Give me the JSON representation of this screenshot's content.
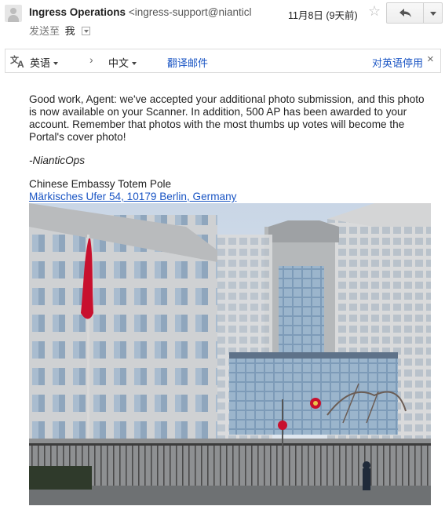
{
  "header": {
    "sender_name": "Ingress Operations",
    "sender_email": "<ingress-support@nianticl",
    "date": "11月8日 (9天前)",
    "to_label": "发送至",
    "to_value": "我"
  },
  "translate_bar": {
    "from_lang": "英语",
    "to_lang": "中文",
    "translate_label": "翻译邮件",
    "stop_label": "对英语停用",
    "close": "×"
  },
  "message": {
    "body": "Good work, Agent: we've accepted your additional photo submission, and this photo is now available on your Scanner. In addition, 500 AP has been awarded to your account. Remember that photos with the most thumbs up votes will become the Portal's cover photo!",
    "signature": "-NianticOps",
    "portal_name": "Chinese Embassy Totem Pole",
    "portal_address": "Märkisches Ufer 54, 10179 Berlin, Germany"
  },
  "colors": {
    "link": "#1a55c4",
    "flag": "#c8102e"
  },
  "icons": {
    "star": "star-icon",
    "reply": "reply-icon",
    "translate": "translate-icon"
  }
}
